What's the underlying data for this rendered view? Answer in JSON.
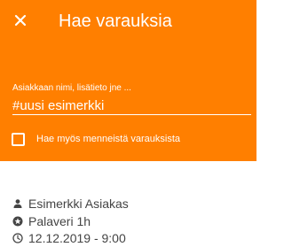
{
  "header": {
    "close_icon": "close-icon",
    "title": "Hae varauksia",
    "background_color": "#ff7f00"
  },
  "search": {
    "label": "Asiakkaan nimi, lisätieto jne ...",
    "value": "#uusi esimerkki"
  },
  "past_checkbox": {
    "label": "Hae myös menneistä varauksista",
    "checked": false
  },
  "results": [
    {
      "customer": "Esimerkki Asiakas",
      "customer_icon": "person-icon",
      "service": "Palaveri 1h",
      "service_icon": "service-icon",
      "datetime": "12.12.2019 - 9:00",
      "datetime_icon": "clock-icon"
    }
  ]
}
